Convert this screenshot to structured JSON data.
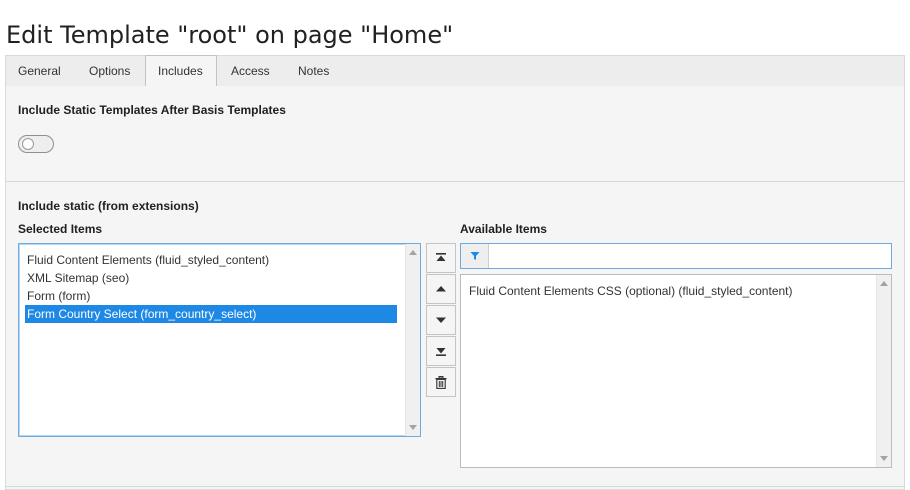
{
  "page": {
    "title": "Edit Template \"root\" on page \"Home\""
  },
  "tabs": [
    {
      "label": "General",
      "active": false
    },
    {
      "label": "Options",
      "active": false
    },
    {
      "label": "Includes",
      "active": true
    },
    {
      "label": "Access",
      "active": false
    },
    {
      "label": "Notes",
      "active": false
    }
  ],
  "static_templates": {
    "label": "Include Static Templates After Basis Templates",
    "toggle_on": false
  },
  "include_static": {
    "label": "Include static (from extensions)",
    "selected_label": "Selected Items",
    "available_label": "Available Items",
    "selected_items": [
      {
        "label": "Fluid Content Elements (fluid_styled_content)",
        "selected": false
      },
      {
        "label": "XML Sitemap (seo)",
        "selected": false
      },
      {
        "label": "Form (form)",
        "selected": false
      },
      {
        "label": "Form Country Select (form_country_select)",
        "selected": true
      }
    ],
    "available_items": [
      {
        "label": "Fluid Content Elements CSS (optional) (fluid_styled_content)"
      }
    ],
    "filter": {
      "value": "",
      "placeholder": ""
    },
    "buttons": [
      {
        "name": "move-to-top-button",
        "icon": "move-top-icon"
      },
      {
        "name": "move-up-button",
        "icon": "arrow-up-icon"
      },
      {
        "name": "move-down-button",
        "icon": "arrow-down-icon"
      },
      {
        "name": "move-to-bottom-button",
        "icon": "move-bottom-icon"
      },
      {
        "name": "remove-button",
        "icon": "trash-icon"
      }
    ]
  },
  "colors": {
    "accent": "#1e88e5",
    "focus_border": "#6daae0",
    "panel_bg": "#f5f5f5"
  }
}
